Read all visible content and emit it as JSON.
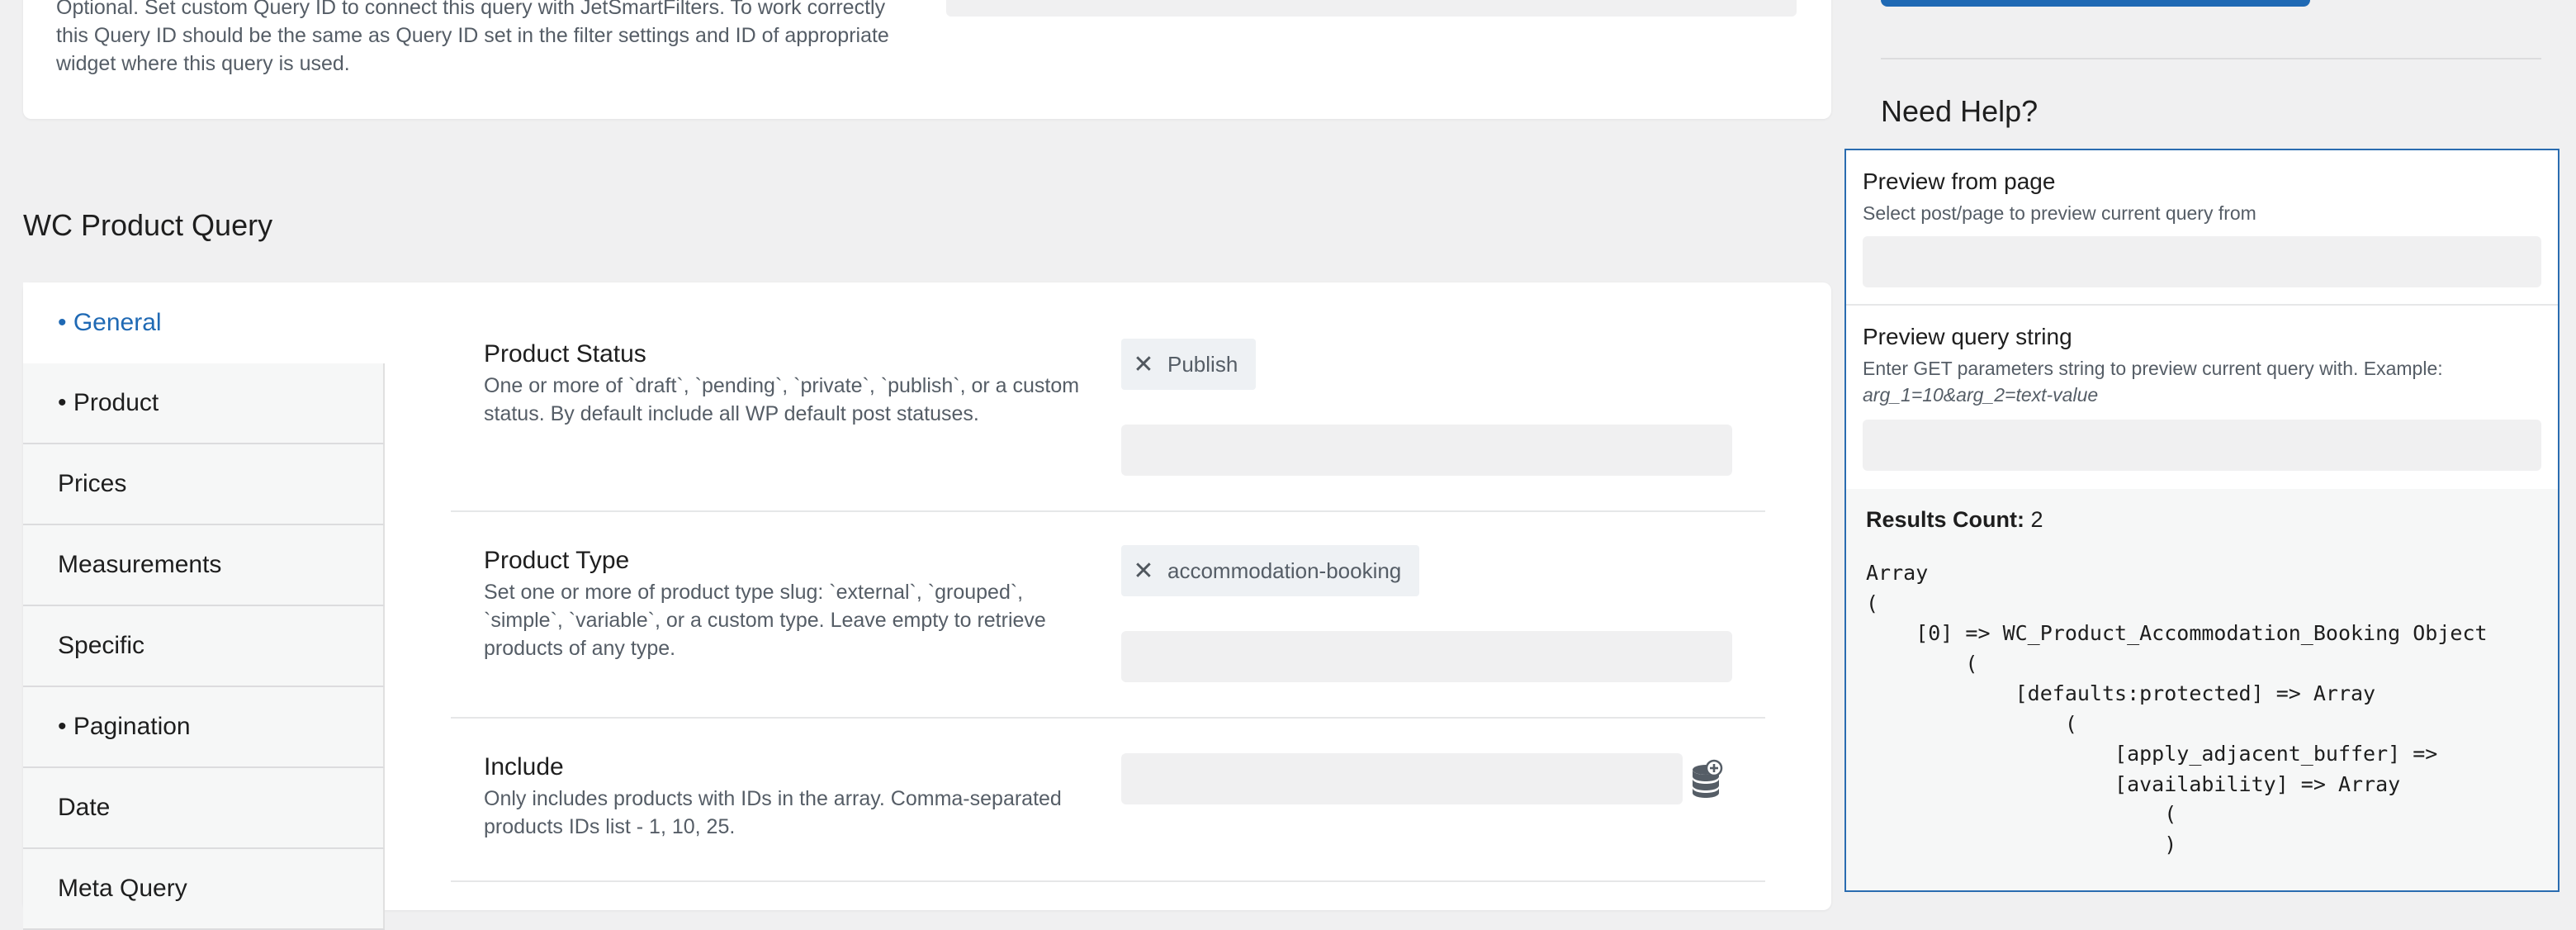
{
  "top_section": {
    "description": "Optional. Set custom Query ID to connect this query with JetSmartFilters. To work correctly this Query ID should be the same as Query ID set in the filter settings and ID of appropriate widget where this query is used."
  },
  "sidebar": {
    "need_help": "Need Help?",
    "preview_from_page": {
      "label": "Preview from page",
      "description": "Select post/page to preview current query from"
    },
    "preview_query_string": {
      "label": "Preview query string",
      "description": "Enter GET parameters string to preview current query with. Example:",
      "example": "arg_1=10&arg_2=text-value"
    },
    "results": {
      "label": "Results Count:",
      "count": "2",
      "output_lines": [
        "Array",
        "(",
        "    [0] => WC_Product_Accommodation_Booking Object",
        "        (",
        "            [defaults:protected] => Array",
        "                (",
        "                    [apply_adjacent_buffer] =>",
        "                    [availability] => Array",
        "                        (",
        "                        )"
      ]
    }
  },
  "section_title": "WC Product Query",
  "tabs": [
    {
      "label": "• General",
      "active": true
    },
    {
      "label": "• Product",
      "active": false
    },
    {
      "label": "Prices",
      "active": false
    },
    {
      "label": "Measurements",
      "active": false
    },
    {
      "label": "Specific",
      "active": false
    },
    {
      "label": "• Pagination",
      "active": false
    },
    {
      "label": "Date",
      "active": false
    },
    {
      "label": "Meta Query",
      "active": false
    }
  ],
  "fields": {
    "product_status": {
      "label": "Product Status",
      "description": "One or more of `draft`, `pending`, `private`, `publish`, or a custom status. By default include all WP default post statuses.",
      "chip": "Publish"
    },
    "product_type": {
      "label": "Product Type",
      "description": "Set one or more of product type slug: `external`, `grouped`, `simple`, `variable`, or a custom type. Leave empty to retrieve products of any type.",
      "chip": "accommodation-booking"
    },
    "include": {
      "label": "Include",
      "description": "Only includes products with IDs in the array. Comma-separated products IDs list - 1, 10, 25."
    }
  },
  "icons": {
    "chip_remove": "close-icon",
    "dynamic_tags": "database-plus-icon"
  },
  "colors": {
    "accent": "#1f69b4",
    "panel_border": "#2a6cb0"
  }
}
